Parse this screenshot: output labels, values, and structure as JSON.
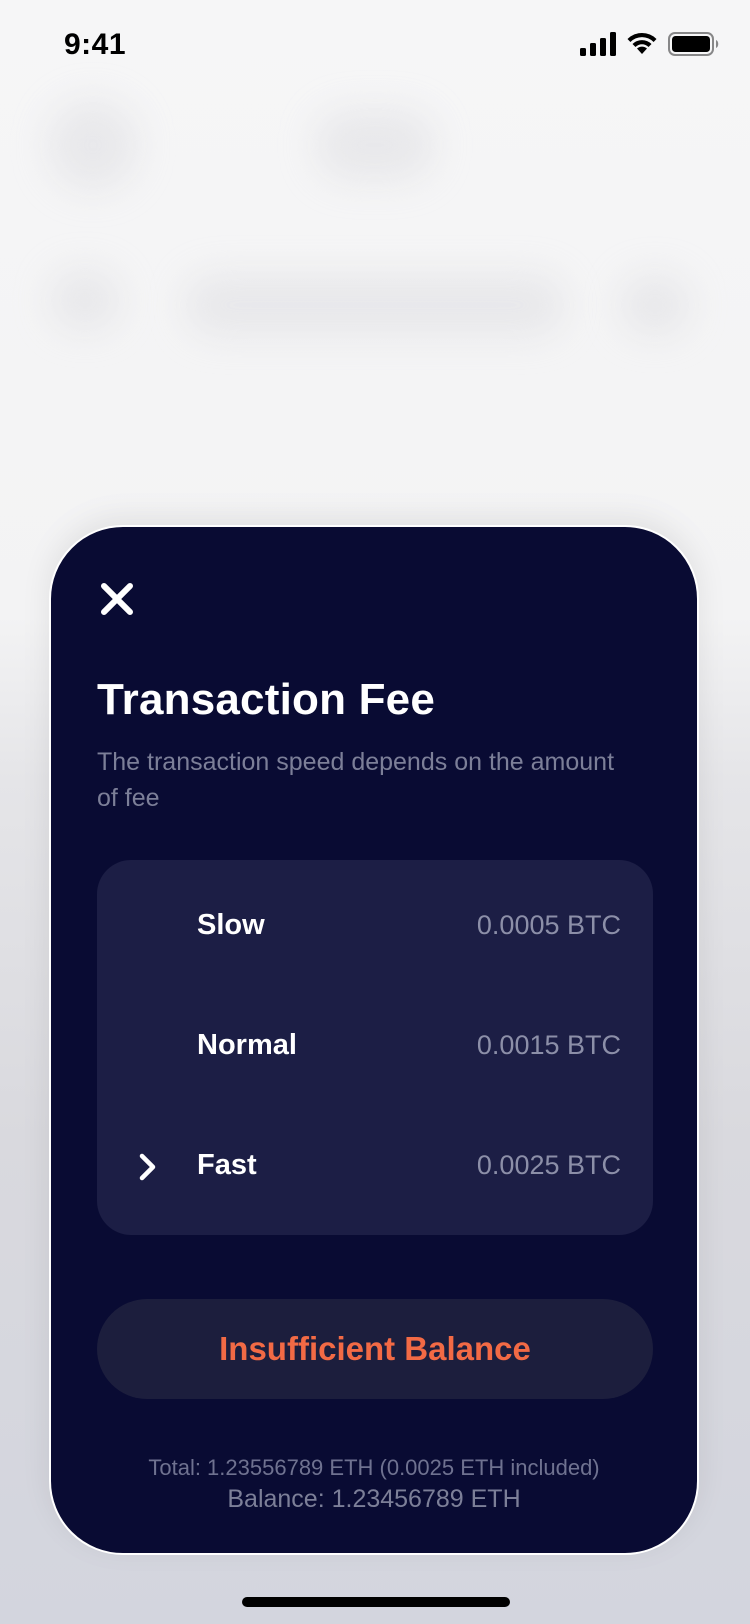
{
  "status_bar": {
    "time": "9:41",
    "icons": [
      "signal-icon",
      "wifi-icon",
      "battery-icon"
    ]
  },
  "sheet": {
    "close_icon": "close-icon",
    "title": "Transaction Fee",
    "subtitle": "The transaction speed depends on the amount of fee",
    "options": [
      {
        "label": "Slow",
        "value": "0.0005 BTC",
        "selected": false
      },
      {
        "label": "Normal",
        "value": "0.0015 BTC",
        "selected": false
      },
      {
        "label": "Fast",
        "value": "0.0025 BTC",
        "selected": true
      }
    ],
    "button_label": "Insufficient Balance",
    "total": "Total: 1.23556789 ETH (0.0025 ETH included)",
    "balance": "Balance: 1.23456789 ETH"
  },
  "colors": {
    "sheet_background": "#090b33",
    "options_background": "#1c1e45",
    "button_text": "#f26a45",
    "muted_text": "#7c7f98"
  }
}
